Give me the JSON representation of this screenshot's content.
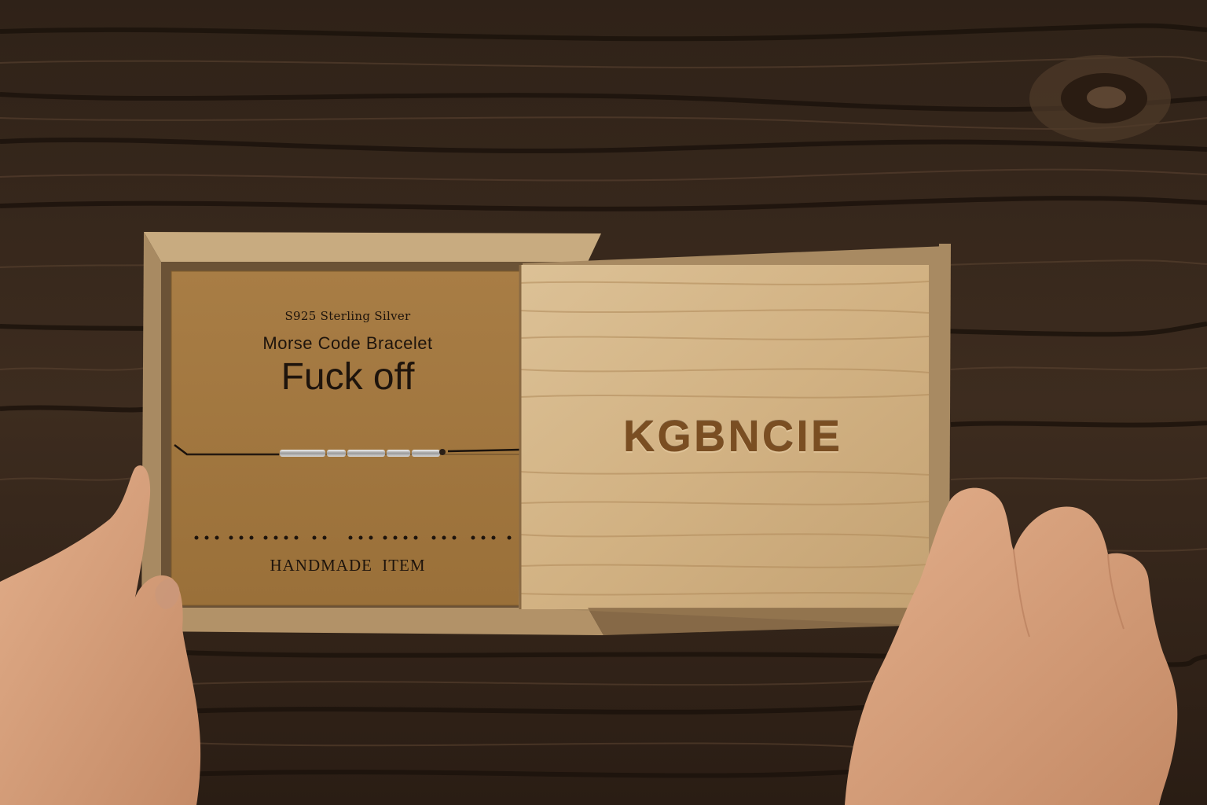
{
  "card": {
    "material": "S925 Sterling Silver",
    "product": "Morse Code Bracelet",
    "message": "Fuck off",
    "footer": "HANDMADE   ITEM"
  },
  "lid": {
    "brand": "KGBNCIE"
  },
  "colors": {
    "table_dark": "#2a1d14",
    "table_mid": "#4a3526",
    "box_wood": "#b89a72",
    "lid_wood": "#d6b98a",
    "kraft_card": "#a0763f",
    "skin": "#d9a37d"
  },
  "icons": {
    "bracelet": "silver-tube-on-black-cord",
    "morse": "dot-dash-row"
  }
}
